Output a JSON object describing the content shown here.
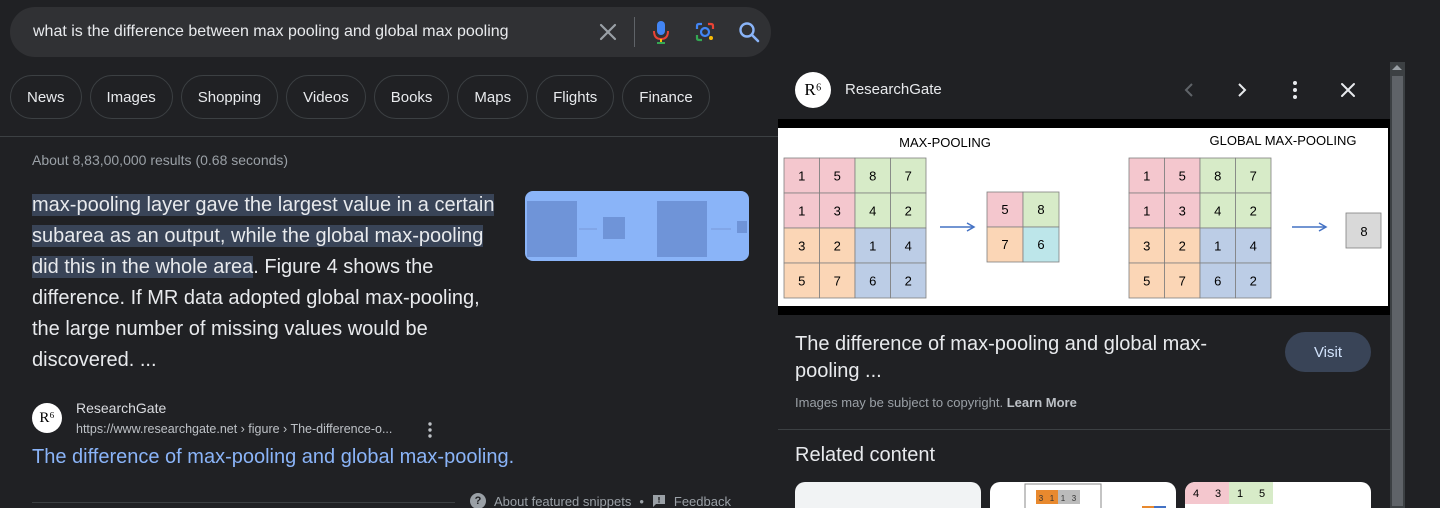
{
  "search": {
    "query": "what is the difference between max pooling and global max pooling"
  },
  "tabs": [
    "News",
    "Images",
    "Shopping",
    "Videos",
    "Books",
    "Maps",
    "Flights",
    "Finance"
  ],
  "stats": "About 8,83,00,000 results (0.68 seconds)",
  "snippet": {
    "highlight": "max-pooling layer gave the largest value in a certain subarea as an output, while the global max-pooling did this in the whole area",
    "rest": ". Figure 4 shows the difference. If MR data adopted global max-pooling, the large number of missing values would be discovered. ..."
  },
  "source": {
    "favicon": "R⁶",
    "name": "ResearchGate",
    "url": "https://www.researchgate.net › figure › The-difference-o...",
    "link_title": "The difference of max-pooling and global max-pooling."
  },
  "snippet_footer": {
    "about": "About featured snippets",
    "dot": "•",
    "feedback": "Feedback"
  },
  "panel": {
    "favicon": "R⁶",
    "site": "ResearchGate",
    "title": "The difference of max-pooling and global max-pooling ...",
    "visit": "Visit",
    "copyright": "Images may be subject to copyright.",
    "learn_more": "Learn More",
    "related_title": "Related content"
  },
  "figure": {
    "left_title": "MAX-POOLING",
    "right_title": "GLOBAL MAX-POOLING",
    "grid": [
      [
        1,
        5,
        8,
        7
      ],
      [
        1,
        3,
        4,
        2
      ],
      [
        3,
        2,
        1,
        4
      ],
      [
        5,
        7,
        6,
        2
      ]
    ],
    "pooled": [
      [
        5,
        8
      ],
      [
        7,
        6
      ]
    ],
    "global": 8,
    "colors": {
      "pink": "#f4c7ce",
      "green": "#d7ebc8",
      "orange": "#fbd6b6",
      "blue": "#bccde6",
      "cyan": "#bde6ea",
      "gray": "#d9d9d9",
      "arrow": "#4472c4"
    }
  },
  "related_cards": [
    {
      "cells": []
    },
    {
      "cells": [
        "3",
        "1",
        "1",
        "3"
      ]
    },
    {
      "cells": [
        "4",
        "3",
        "1",
        "5"
      ]
    }
  ]
}
